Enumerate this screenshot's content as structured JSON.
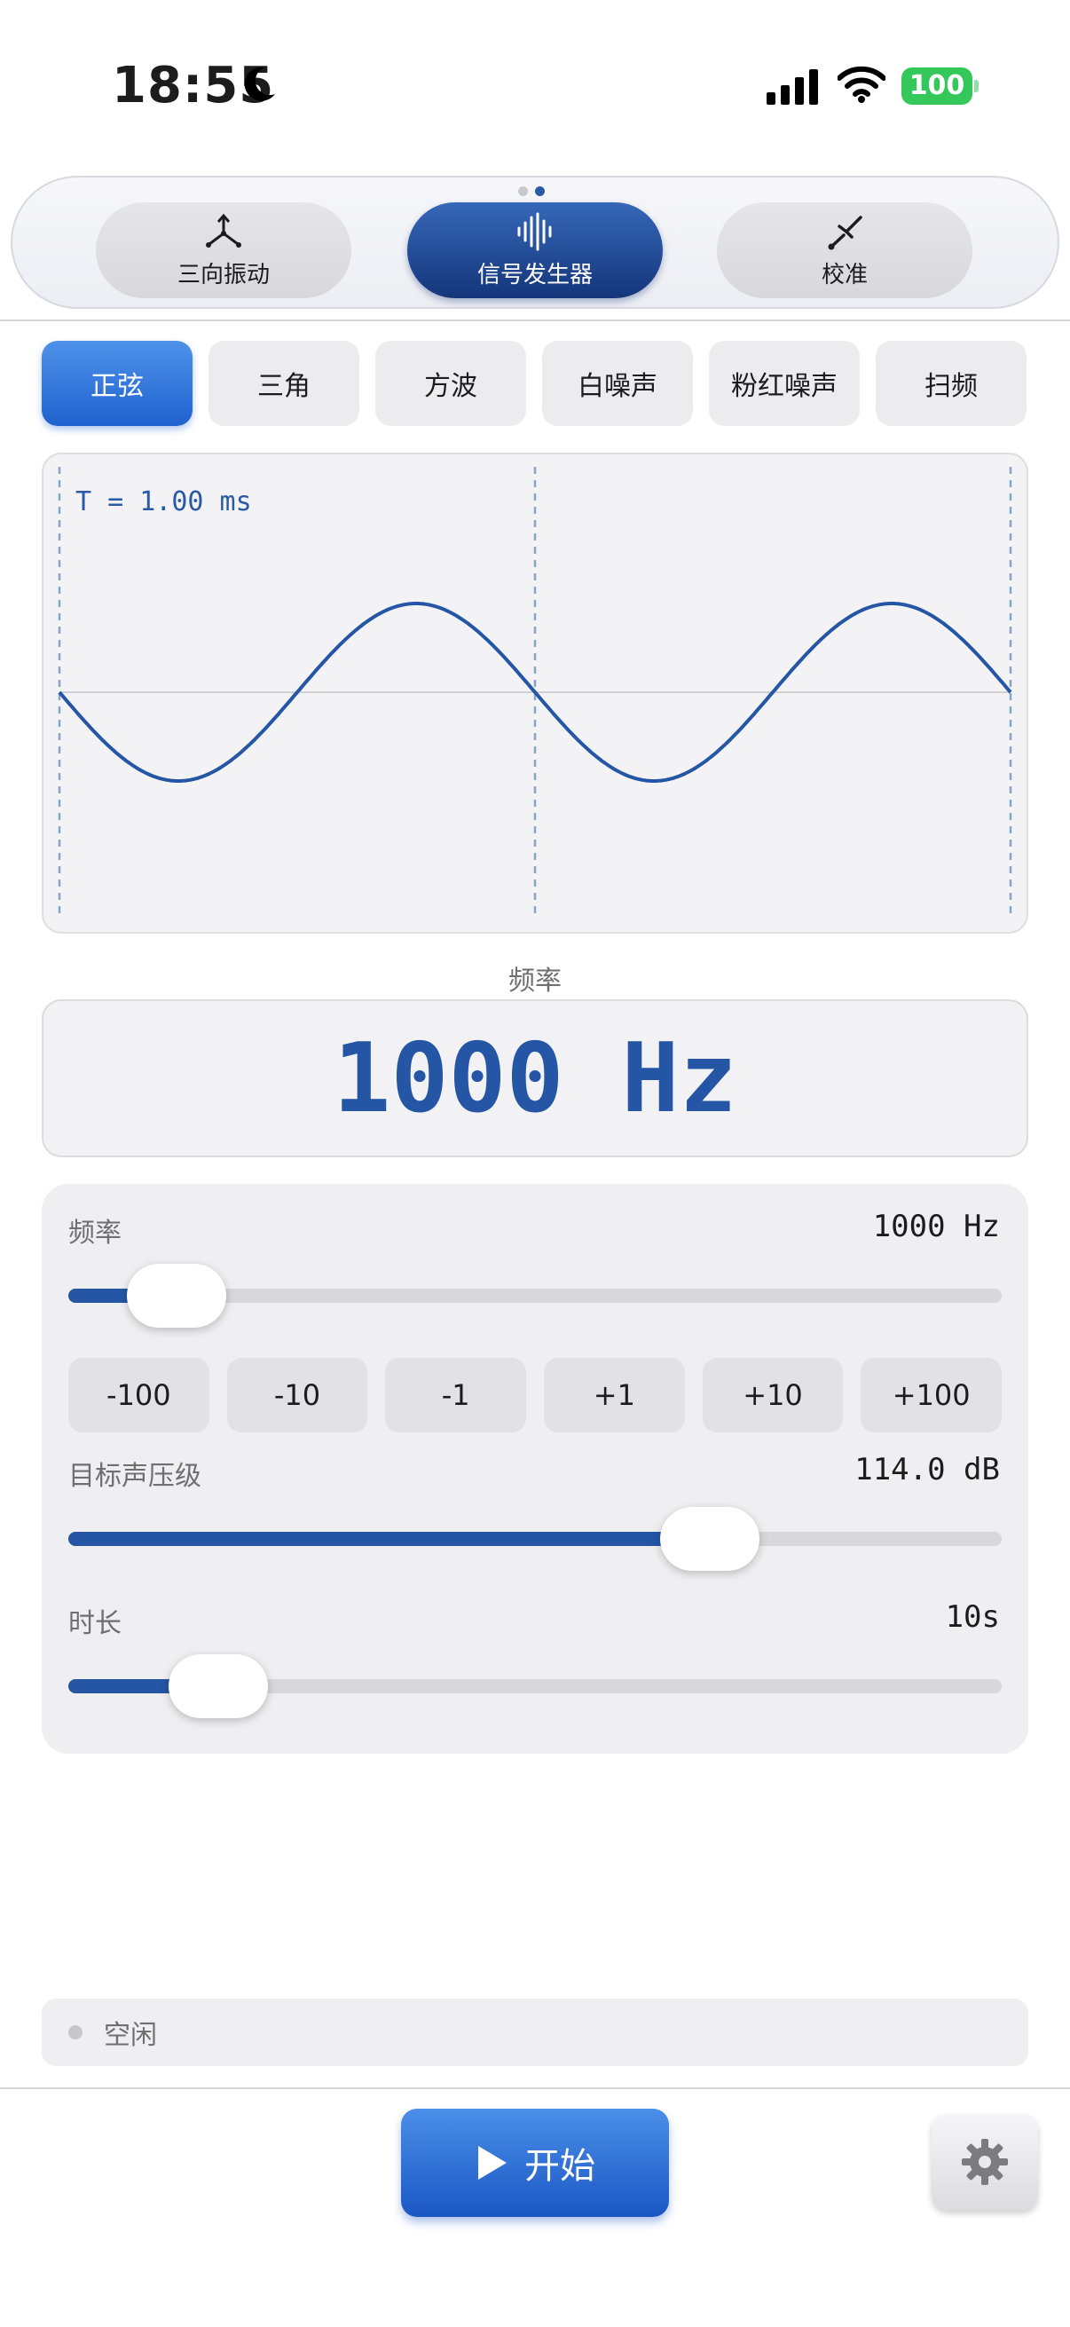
{
  "status_bar": {
    "time": "18:55",
    "battery": "100",
    "icons": [
      "moon-icon",
      "cellular-signal-icon",
      "wifi-icon",
      "battery-icon"
    ]
  },
  "modes": [
    {
      "label": "三向振动",
      "icon": "three-axis-icon",
      "active": false
    },
    {
      "label": "信号发生器",
      "icon": "waveform-icon",
      "active": true
    },
    {
      "label": "校准",
      "icon": "tuning-fork-icon",
      "active": false
    }
  ],
  "waveforms": [
    "正弦",
    "三角",
    "方波",
    "白噪声",
    "粉红噪声",
    "扫频"
  ],
  "active_waveform": "正弦",
  "scope": {
    "period_label": "T = 1.00 ms",
    "waveform": "sine",
    "cycles_shown": 2
  },
  "frequency_display": {
    "caption": "频率",
    "value": "1000 Hz"
  },
  "controls": {
    "frequency": {
      "label": "频率",
      "value": "1000 Hz",
      "level": 0.07
    },
    "steps": [
      "-100",
      "-10",
      "-1",
      "+1",
      "+10",
      "+100"
    ],
    "spl": {
      "label": "目标声压级",
      "value": "114.0 dB",
      "level": 0.71
    },
    "duration": {
      "label": "时长",
      "value": "10s",
      "level": 0.12
    }
  },
  "status": {
    "text": "空闲"
  },
  "actions": {
    "start_label": "开始",
    "settings_icon": "gear-icon"
  },
  "colors": {
    "accent": "#2456a5",
    "active_chip": "#1f62cf",
    "battery": "#34c759"
  }
}
